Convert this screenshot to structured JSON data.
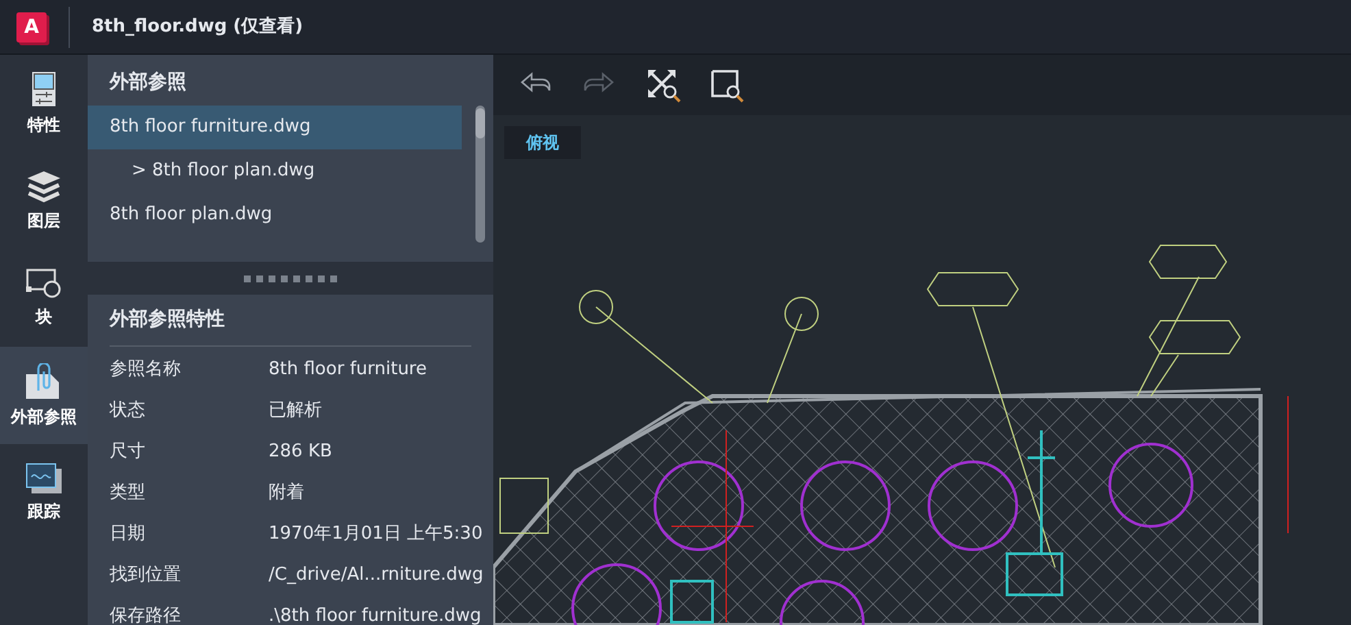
{
  "window": {
    "logo": "A",
    "title": "8th_floor.dwg (仅查看)"
  },
  "rail": [
    {
      "label": "特性",
      "kind": "properties",
      "selected": false
    },
    {
      "label": "图层",
      "kind": "layers",
      "selected": false
    },
    {
      "label": "块",
      "kind": "block",
      "selected": false
    },
    {
      "label": "外部参照",
      "kind": "xref",
      "selected": true
    },
    {
      "label": "跟踪",
      "kind": "trace",
      "selected": false
    }
  ],
  "xref_panel": {
    "title": "外部参照",
    "items": [
      {
        "label": "8th floor furniture.dwg",
        "selected": true,
        "children": [
          {
            "label": "> 8th floor plan.dwg",
            "selected": false
          }
        ]
      },
      {
        "label": "8th floor plan.dwg",
        "selected": false
      }
    ]
  },
  "properties": {
    "title": "外部参照特性",
    "rows": [
      {
        "label": "参照名称",
        "value": "8th floor furniture"
      },
      {
        "label": "状态",
        "value": "已解析"
      },
      {
        "label": "尺寸",
        "value": "286 KB"
      },
      {
        "label": "类型",
        "value": "附着"
      },
      {
        "label": "日期",
        "value": "1970年1月01日 上午5:30"
      },
      {
        "label": "找到位置",
        "value": "/C_drive/Al...rniture.dwg"
      },
      {
        "label": "保存路径",
        "value": ".\\8th floor furniture.dwg"
      }
    ]
  },
  "toolbar": [
    {
      "kind": "undo",
      "disabled": false
    },
    {
      "kind": "redo",
      "disabled": true
    },
    {
      "kind": "zoomextents",
      "disabled": false
    },
    {
      "kind": "zoomwindow",
      "disabled": false
    }
  ],
  "view_label": "俯视"
}
